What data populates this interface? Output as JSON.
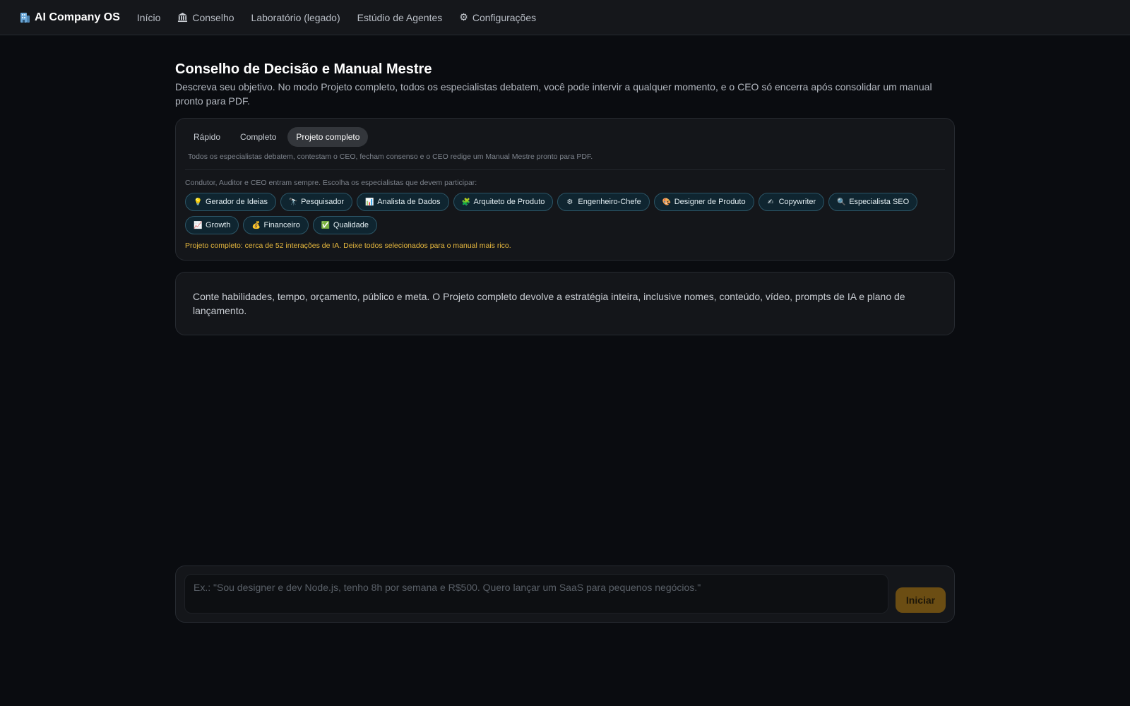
{
  "colors": {
    "background": "#0a0c10",
    "card": "#14161a",
    "chip_bg": "#0f2530",
    "chip_border": "#2c5566",
    "warning": "#e8b93e",
    "start_button": "#6b4d13"
  },
  "topbar": {
    "brand": {
      "icon": "building-icon",
      "label": "AI Company OS"
    },
    "nav": [
      {
        "label": "Início",
        "icon": ""
      },
      {
        "label": "Conselho",
        "icon": "classical-building-icon"
      },
      {
        "label": "Laboratório (legado)",
        "icon": ""
      },
      {
        "label": "Estúdio de Agentes",
        "icon": ""
      },
      {
        "label": "Configurações",
        "icon": "gear-icon"
      }
    ]
  },
  "page": {
    "title": "Conselho de Decisão e Manual Mestre",
    "subtitle": "Descreva seu objetivo. No modo Projeto completo, todos os especialistas debatem, você pode intervir a qualquer momento, e o CEO só encerra após consolidar um manual pronto para PDF."
  },
  "config": {
    "tabs": [
      {
        "label": "Rápido",
        "active": false
      },
      {
        "label": "Completo",
        "active": false
      },
      {
        "label": "Projeto completo",
        "active": true
      }
    ],
    "mode_description": "Todos os especialistas debatem, contestam o CEO, fecham consenso e o CEO redige um Manual Mestre pronto para PDF.",
    "select_hint": "Condutor, Auditor e CEO entram sempre. Escolha os especialistas que devem participar:",
    "specialists": [
      {
        "label": "Gerador de Ideias",
        "icon": "lightbulb-icon",
        "glyph": "💡"
      },
      {
        "label": "Pesquisador",
        "icon": "telescope-icon",
        "glyph": "🔭"
      },
      {
        "label": "Analista de Dados",
        "icon": "bar-chart-icon",
        "glyph": "📊"
      },
      {
        "label": "Arquiteto de Produto",
        "icon": "puzzle-icon",
        "glyph": "🧩"
      },
      {
        "label": "Engenheiro-Chefe",
        "icon": "gear-icon",
        "glyph": "⚙"
      },
      {
        "label": "Designer de Produto",
        "icon": "palette-icon",
        "glyph": "🎨"
      },
      {
        "label": "Copywriter",
        "icon": "writing-hand-icon",
        "glyph": "✍"
      },
      {
        "label": "Especialista SEO",
        "icon": "magnifier-icon",
        "glyph": "🔍"
      },
      {
        "label": "Growth",
        "icon": "trending-up-icon",
        "glyph": "📈"
      },
      {
        "label": "Financeiro",
        "icon": "money-bag-icon",
        "glyph": "💰"
      },
      {
        "label": "Qualidade",
        "icon": "check-box-icon",
        "glyph": "✅"
      }
    ],
    "warning": "Projeto completo: cerca de 52 interações de IA. Deixe todos selecionados para o manual mais rico."
  },
  "info": {
    "text": "Conte habilidades, tempo, orçamento, público e meta. O Projeto completo devolve a estratégia inteira, inclusive nomes, conteúdo, vídeo, prompts de IA e plano de lançamento."
  },
  "composer": {
    "value": "",
    "placeholder": "Ex.: \"Sou designer e dev Node.js, tenho 8h por semana e R$500. Quero lançar um SaaS para pequenos negócios.\"",
    "submit_label": "Iniciar"
  }
}
